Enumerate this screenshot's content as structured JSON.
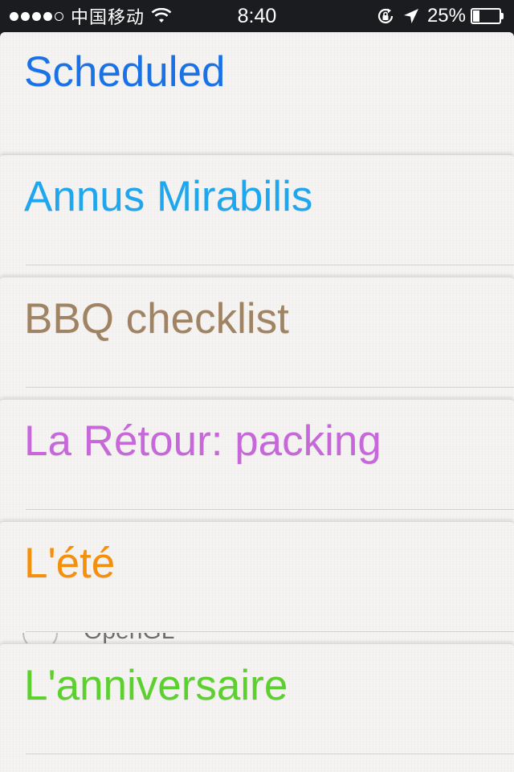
{
  "status_bar": {
    "carrier": "中国移动",
    "time": "8:40",
    "battery_percent": "25%",
    "battery_level": 0.25,
    "signal_bars_filled": 4,
    "signal_bars_total": 5
  },
  "lists": [
    {
      "title": "Scheduled",
      "color": "#1a73e6"
    },
    {
      "title": "Annus Mirabilis",
      "color": "#1ea6ef"
    },
    {
      "title": "BBQ checklist",
      "color": "#a08362"
    },
    {
      "title": "La Rétour: packing",
      "color": "#c668d9"
    },
    {
      "title": "L'été",
      "color": "#f4900c",
      "peek_item": "OpenGL"
    },
    {
      "title": "L'anniversaire",
      "color": "#5cd02e"
    }
  ],
  "icons": {
    "wifi": "wifi-icon",
    "rotation_lock": "rotation-lock-icon",
    "location": "location-arrow-icon",
    "battery": "battery-icon"
  }
}
